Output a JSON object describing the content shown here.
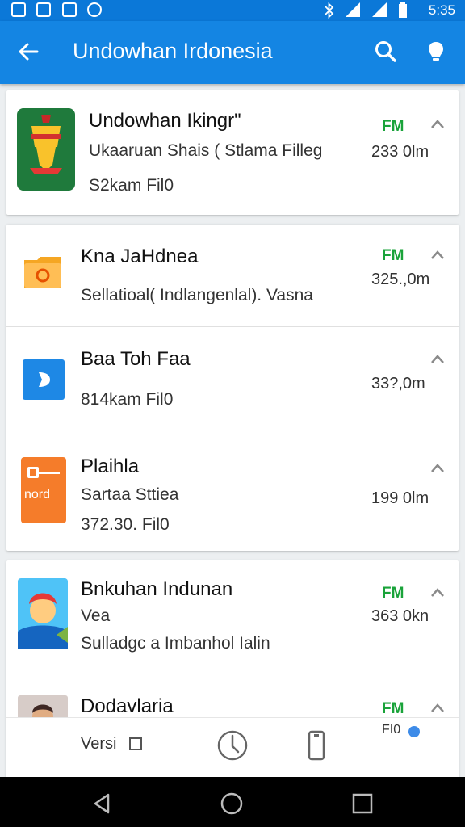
{
  "status_bar": {
    "time": "5:35",
    "left_icons": [
      "gallery-icon",
      "image-icon",
      "screenshot-icon",
      "messenger-icon"
    ],
    "right_icons": [
      "bluetooth-icon",
      "signal-icon",
      "signal-icon",
      "battery-icon"
    ]
  },
  "app_bar": {
    "title": "Undowhan Irdonesia",
    "back_icon": "arrow-left-icon",
    "actions": [
      "search-icon",
      "lightbulb-icon"
    ]
  },
  "items": [
    {
      "title": "Undowhan Ikingr\"",
      "line2": "Ukaaruan Shais ( Stlama Filleg",
      "line3": "S2kam Fil0",
      "size": "233 0lm",
      "badge": "FM",
      "thumb": "shield-helmet-icon"
    },
    {
      "title": "Kna JaHdnea",
      "line2": "Sellatioal( Indlangenlal). Vasna",
      "size": "325.,0m",
      "badge": "FM",
      "thumb": "folder-orange-icon"
    },
    {
      "title": "Baa Toh Faa",
      "line3": "814kam Fil0",
      "size": "33?,0m",
      "thumb": "play-blue-icon"
    },
    {
      "title": "Plaihla",
      "line2": "Sartaa Sttiea",
      "line3": "372.30. Fil0",
      "size": "199 0lm",
      "thumb_text": "nord",
      "thumb": "orange-app-icon"
    },
    {
      "title": "Bnkuhan Indunan",
      "line2": "Vea",
      "line3": "Sulladgc a Imbanhol Ialin",
      "size": "363 0kn",
      "badge": "FM",
      "thumb": "cartoon-avatar-icon"
    },
    {
      "title": "Dodavlaria",
      "line2": "Versi",
      "size": "FI0",
      "badge": "FM",
      "thumb": "person-photo-icon"
    }
  ],
  "bottom_icons": [
    "clock-icon",
    "phone-icon"
  ],
  "nav_bar": [
    "back-triangle-icon",
    "home-circle-icon",
    "recents-square-icon"
  ],
  "colors": {
    "appbar": "#1485e3",
    "statusbar": "#0b78d8",
    "badge": "#1aa33a"
  }
}
